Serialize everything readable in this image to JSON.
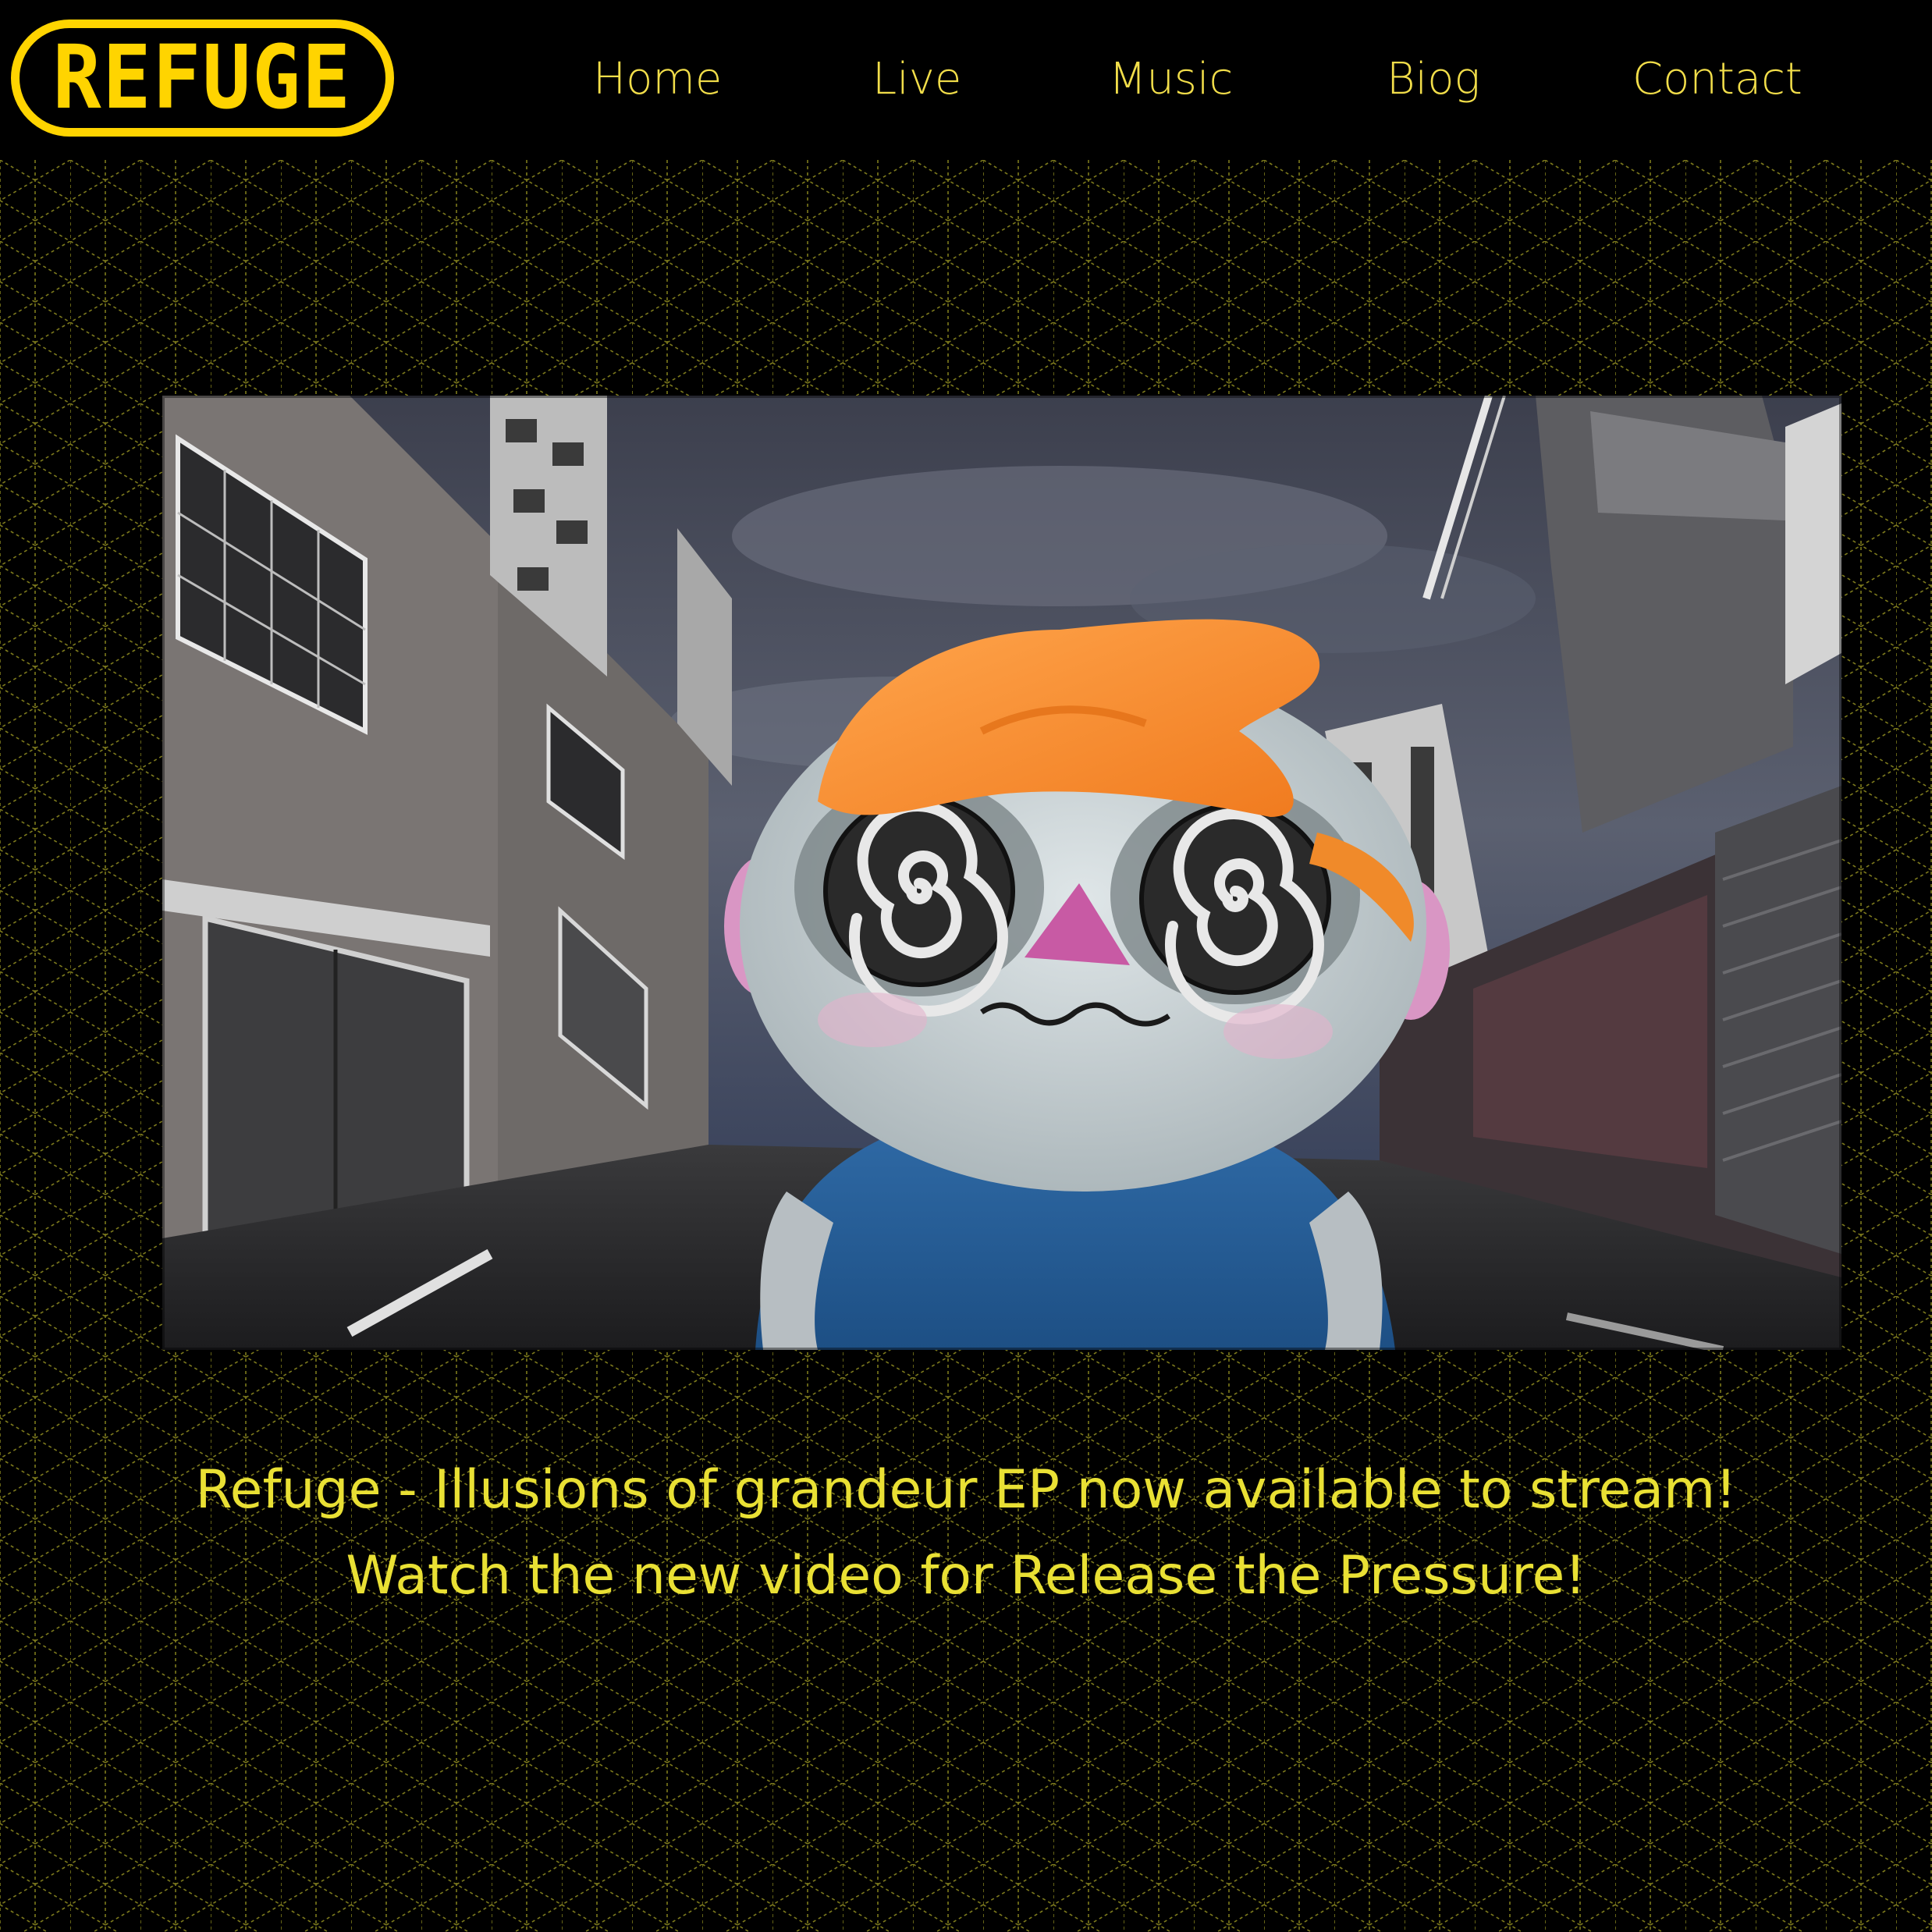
{
  "brand": {
    "logo_text": "REFUGE",
    "accent_color": "#ffd400",
    "nav_text_color": "#f2de4a"
  },
  "nav": {
    "home": "Home",
    "live": "Live",
    "music": "Music",
    "biog": "Biog",
    "contact": "Contact"
  },
  "hero": {
    "video_thumbnail": "animated-character-in-city-street",
    "caption_line_1": "Refuge - Illusions of grandeur EP now available to stream!",
    "caption_line_2": "Watch the new video for Release the Pressure!"
  },
  "background": {
    "pattern": "isometric-grid",
    "line_color": "#8a8420"
  }
}
